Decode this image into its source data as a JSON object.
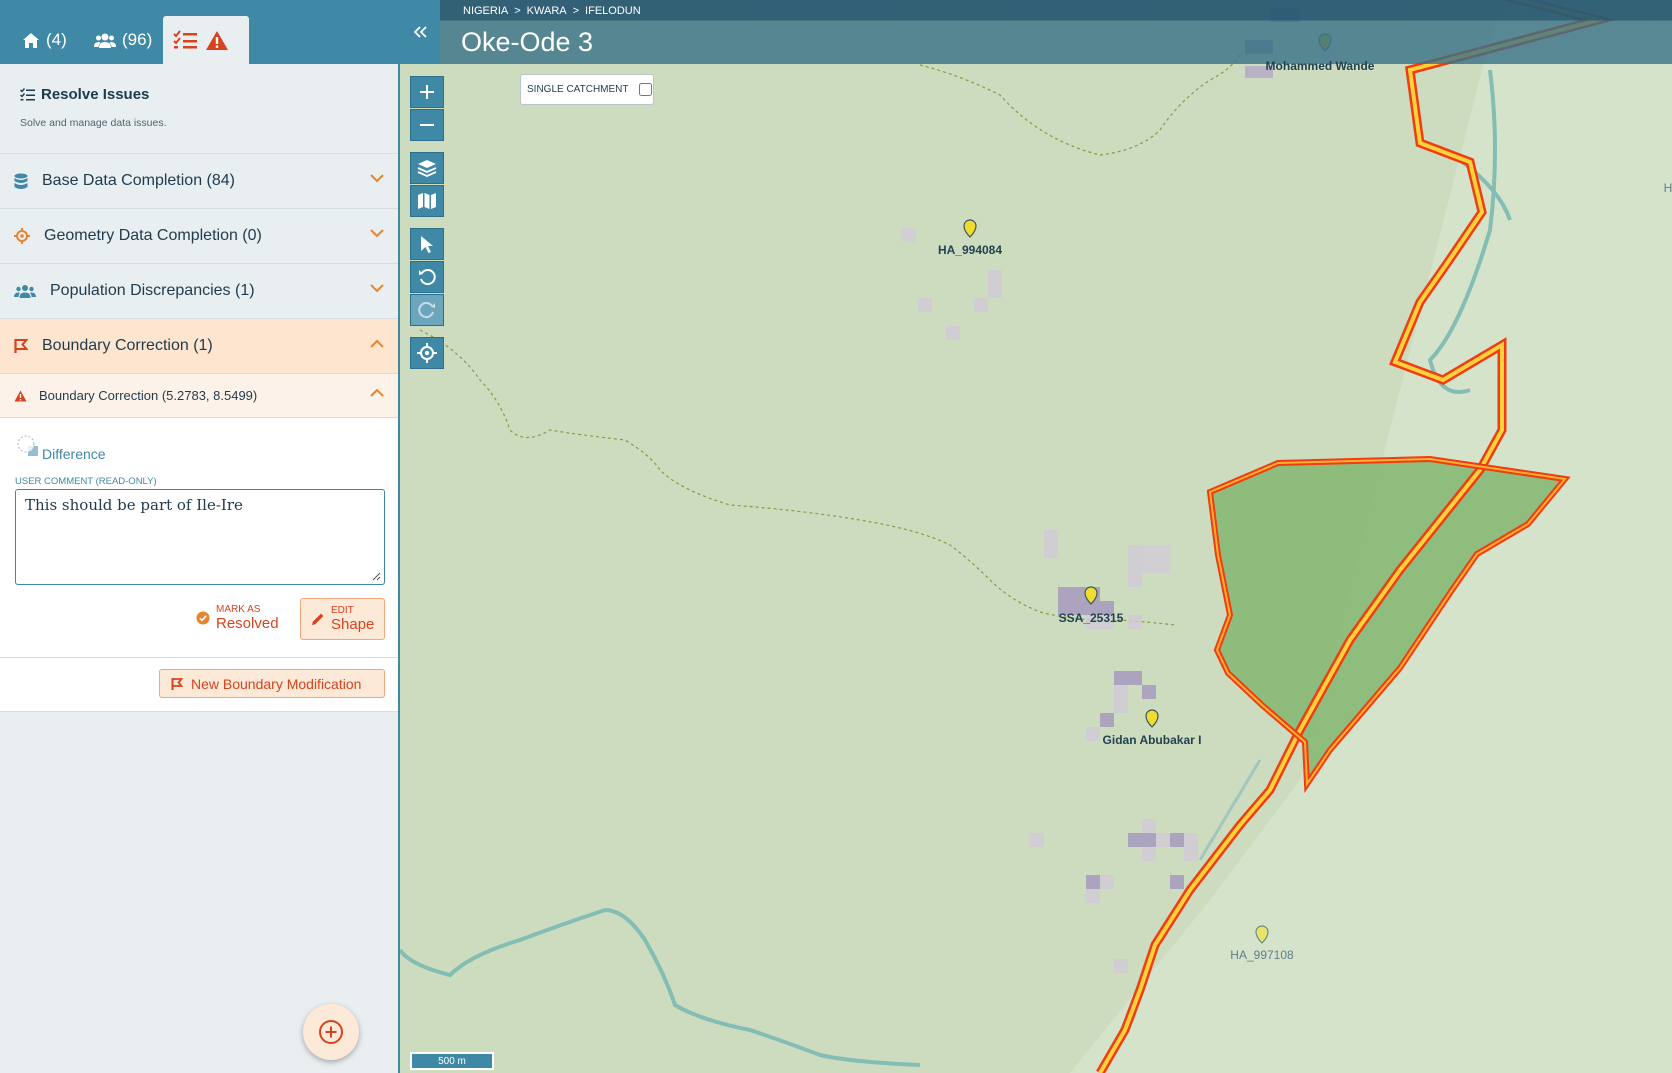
{
  "tabs": [
    {
      "label": "(4)",
      "icon": "home-icon"
    },
    {
      "label": "(96)",
      "icon": "users-icon"
    },
    {
      "label": "",
      "icon": "issues-icon"
    }
  ],
  "resolve": {
    "title": "Resolve Issues",
    "subtitle": "Solve and manage data issues."
  },
  "sections": [
    {
      "label": "Base Data Completion (84)",
      "icon": "database-icon"
    },
    {
      "label": "Geometry Data Completion (0)",
      "icon": "crosshair-icon"
    },
    {
      "label": "Population Discrepancies (1)",
      "icon": "people-icon"
    },
    {
      "label": "Boundary Correction (1)",
      "icon": "boundary-flag-icon"
    }
  ],
  "issue": {
    "title": "Boundary Correction (5.2783, 8.5499)",
    "difference_label": "Difference",
    "comment_label": "USER COMMENT (READ-ONLY)",
    "comment": "This should be part of Ile-Ire",
    "mark_small": "MARK AS",
    "mark_big": "Resolved",
    "edit_small": "EDIT",
    "edit_big": "Shape"
  },
  "new_modification": "New Boundary Modification",
  "map": {
    "breadcrumb": [
      "NIGERIA",
      ">",
      "KWARA",
      ">",
      "IFELODUN"
    ],
    "title": "Oke-Ode 3",
    "single_catchment": "SINGLE CATCHMENT",
    "labels": {
      "mohammed": "Mohammed Wande",
      "ha994084": "HA_994084",
      "ssa25315": "SSA_25315",
      "gidan": "Gidan Abubakar I",
      "ha997108": "HA_997108",
      "edge": "H"
    },
    "scale": "500 m"
  },
  "colors": {
    "primary": "#3f88a6",
    "accent": "#d7431f",
    "boundary_red": "#f03c14",
    "boundary_yellow": "#ffd23a",
    "difference_fill": "#7fb06a"
  }
}
